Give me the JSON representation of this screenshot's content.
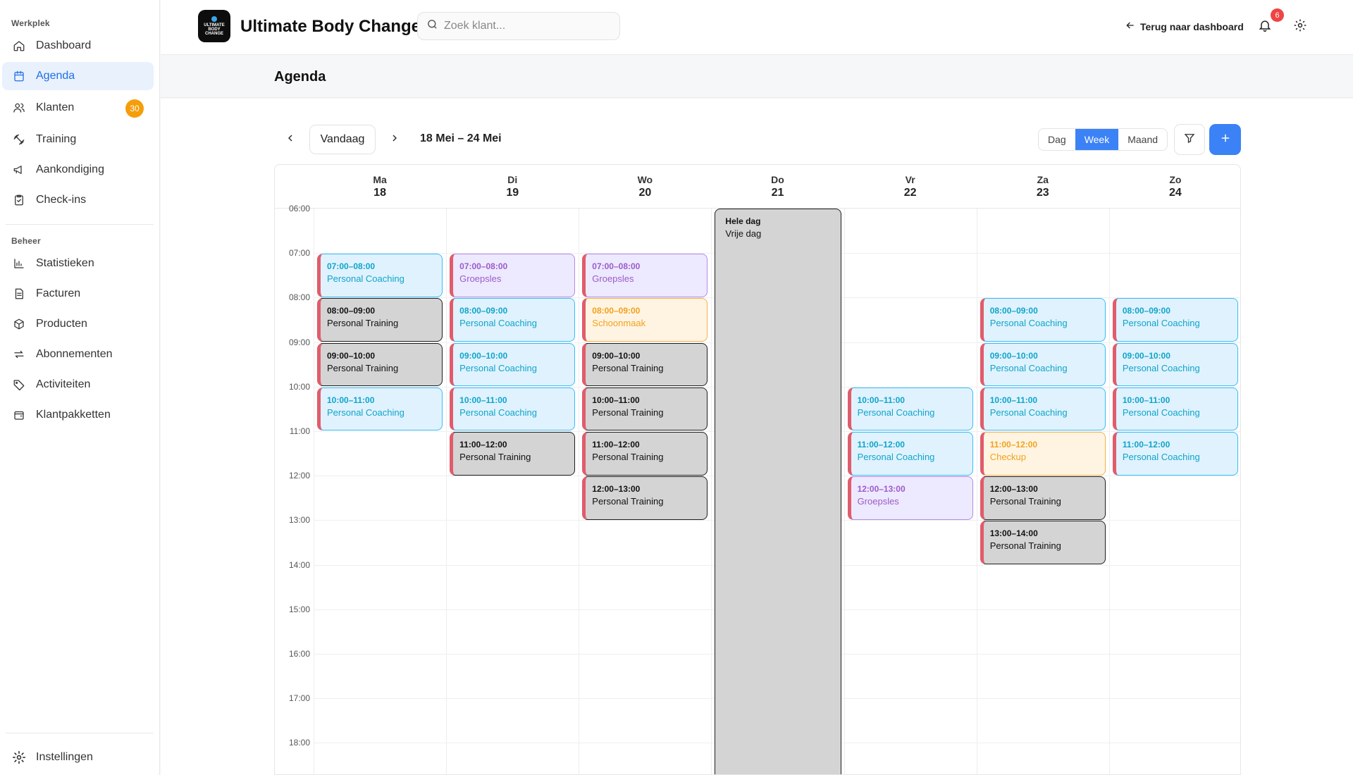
{
  "sidebar": {
    "section_werkplek": "Werkplek",
    "section_beheer": "Beheer",
    "items": [
      {
        "label": "Dashboard"
      },
      {
        "label": "Agenda"
      },
      {
        "label": "Klanten",
        "badge": "30"
      },
      {
        "label": "Training"
      },
      {
        "label": "Aankondiging"
      },
      {
        "label": "Check-ins"
      },
      {
        "label": "Statistieken"
      },
      {
        "label": "Facturen"
      },
      {
        "label": "Producten"
      },
      {
        "label": "Abonnementen"
      },
      {
        "label": "Activiteiten"
      },
      {
        "label": "Klantpakketten"
      }
    ],
    "settings_label": "Instellingen"
  },
  "header": {
    "logo_text": "ULTIMATE BODY CHANGE",
    "app_title": "Ultimate Body Change",
    "search_placeholder": "Zoek klant...",
    "back_label": "Terug naar dashboard",
    "notification_count": "6"
  },
  "page": {
    "title": "Agenda"
  },
  "toolbar": {
    "today_label": "Vandaag",
    "range_label": "18 Mei – 24 Mei",
    "views": [
      "Dag",
      "Week",
      "Maand"
    ],
    "active_view": "Week"
  },
  "calendar": {
    "days": [
      {
        "name": "Ma",
        "date": "18"
      },
      {
        "name": "Di",
        "date": "19"
      },
      {
        "name": "Wo",
        "date": "20"
      },
      {
        "name": "Do",
        "date": "21"
      },
      {
        "name": "Vr",
        "date": "22"
      },
      {
        "name": "Za",
        "date": "23"
      },
      {
        "name": "Zo",
        "date": "24"
      }
    ],
    "hours": [
      "06:00",
      "07:00",
      "08:00",
      "09:00",
      "10:00",
      "11:00",
      "12:00",
      "13:00",
      "14:00",
      "15:00",
      "16:00",
      "17:00",
      "18:00"
    ],
    "all_day": {
      "day": 3,
      "time": "Hele dag",
      "title": "Vrije dag"
    },
    "events": [
      {
        "day": 0,
        "time": "07:00–08:00",
        "title": "Personal Coaching",
        "color": "blue"
      },
      {
        "day": 0,
        "time": "08:00–09:00",
        "title": "Personal Training",
        "color": "gray"
      },
      {
        "day": 0,
        "time": "09:00–10:00",
        "title": "Personal Training",
        "color": "gray"
      },
      {
        "day": 0,
        "time": "10:00–11:00",
        "title": "Personal Coaching",
        "color": "blue"
      },
      {
        "day": 1,
        "time": "07:00–08:00",
        "title": "Groepsles",
        "color": "purple"
      },
      {
        "day": 1,
        "time": "08:00–09:00",
        "title": "Personal Coaching",
        "color": "blue"
      },
      {
        "day": 1,
        "time": "09:00–10:00",
        "title": "Personal Coaching",
        "color": "blue"
      },
      {
        "day": 1,
        "time": "10:00–11:00",
        "title": "Personal Coaching",
        "color": "blue"
      },
      {
        "day": 1,
        "time": "11:00–12:00",
        "title": "Personal Training",
        "color": "gray"
      },
      {
        "day": 2,
        "time": "07:00–08:00",
        "title": "Groepsles",
        "color": "purple"
      },
      {
        "day": 2,
        "time": "08:00–09:00",
        "title": "Schoonmaak",
        "color": "orange"
      },
      {
        "day": 2,
        "time": "09:00–10:00",
        "title": "Personal Training",
        "color": "gray"
      },
      {
        "day": 2,
        "time": "10:00–11:00",
        "title": "Personal Training",
        "color": "gray"
      },
      {
        "day": 2,
        "time": "11:00–12:00",
        "title": "Personal Training",
        "color": "gray"
      },
      {
        "day": 2,
        "time": "12:00–13:00",
        "title": "Personal Training",
        "color": "gray"
      },
      {
        "day": 4,
        "time": "10:00–11:00",
        "title": "Personal Coaching",
        "color": "blue"
      },
      {
        "day": 4,
        "time": "11:00–12:00",
        "title": "Personal Coaching",
        "color": "blue"
      },
      {
        "day": 4,
        "time": "12:00–13:00",
        "title": "Groepsles",
        "color": "purple"
      },
      {
        "day": 5,
        "time": "08:00–09:00",
        "title": "Personal Coaching",
        "color": "blue"
      },
      {
        "day": 5,
        "time": "09:00–10:00",
        "title": "Personal Coaching",
        "color": "blue"
      },
      {
        "day": 5,
        "time": "10:00–11:00",
        "title": "Personal Coaching",
        "color": "blue"
      },
      {
        "day": 5,
        "time": "11:00–12:00",
        "title": "Checkup",
        "color": "orange"
      },
      {
        "day": 5,
        "time": "12:00–13:00",
        "title": "Personal Training",
        "color": "gray"
      },
      {
        "day": 5,
        "time": "13:00–14:00",
        "title": "Personal Training",
        "color": "gray"
      },
      {
        "day": 6,
        "time": "08:00–09:00",
        "title": "Personal Coaching",
        "color": "blue"
      },
      {
        "day": 6,
        "time": "09:00–10:00",
        "title": "Personal Coaching",
        "color": "blue"
      },
      {
        "day": 6,
        "time": "10:00–11:00",
        "title": "Personal Coaching",
        "color": "blue"
      },
      {
        "day": 6,
        "time": "11:00–12:00",
        "title": "Personal Coaching",
        "color": "blue"
      }
    ]
  },
  "colors": {
    "accent": "#3b82f6",
    "badge_orange": "#f59e0b",
    "notification_red": "#ef4444"
  },
  "icons": {
    "sidebar": [
      "home-icon",
      "calendar-icon",
      "users-icon",
      "dumbbell-icon",
      "megaphone-icon",
      "clipboard-icon",
      "bar-chart-icon",
      "file-icon",
      "box-icon",
      "repeat-icon",
      "tag-icon",
      "wallet-icon"
    ]
  }
}
